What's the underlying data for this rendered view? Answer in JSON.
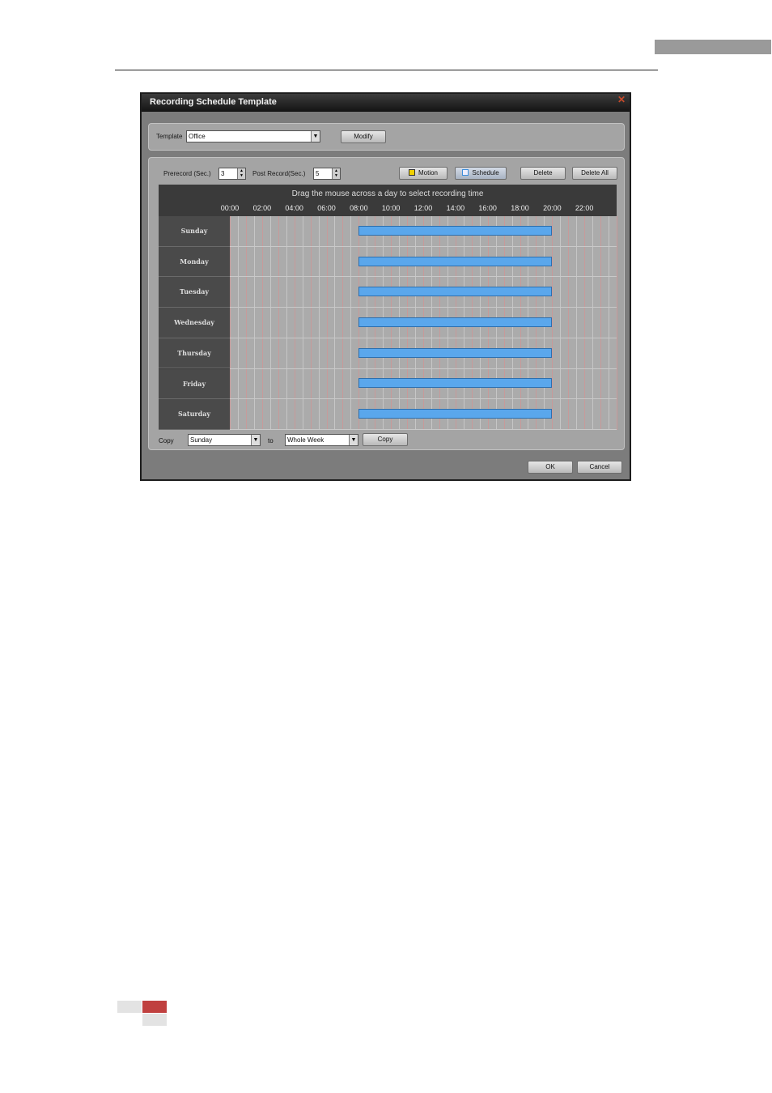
{
  "dialog": {
    "title": "Recording Schedule Template",
    "close_icon": "close-icon"
  },
  "template": {
    "label": "Template",
    "value": "Office",
    "modify_label": "Modify"
  },
  "record": {
    "prerecord_label": "Prerecord (Sec.)",
    "prerecord_value": "3",
    "postrecord_label": "Post Record(Sec.)",
    "postrecord_value": "5"
  },
  "types": {
    "motion_label": "Motion",
    "motion_color": "#f0d000",
    "schedule_label": "Schedule",
    "schedule_color": "#3c8edc",
    "delete_label": "Delete",
    "delete_all_label": "Delete All"
  },
  "schedule": {
    "hint": "Drag the mouse across a day to select recording time",
    "times": [
      "00:00",
      "02:00",
      "04:00",
      "06:00",
      "08:00",
      "10:00",
      "12:00",
      "14:00",
      "16:00",
      "18:00",
      "20:00",
      "22:00"
    ],
    "days": [
      {
        "name": "Sunday",
        "start": 8,
        "end": 20
      },
      {
        "name": "Monday",
        "start": 8,
        "end": 20
      },
      {
        "name": "Tuesday",
        "start": 8,
        "end": 20
      },
      {
        "name": "Wednesday",
        "start": 8,
        "end": 20
      },
      {
        "name": "Thursday",
        "start": 8,
        "end": 20
      },
      {
        "name": "Friday",
        "start": 8,
        "end": 20
      },
      {
        "name": "Saturday",
        "start": 8,
        "end": 20
      }
    ],
    "bar_color": "#5aa7ec",
    "grid_major_color": "#c79a9a",
    "grid_minor_color": "#c6c6c6",
    "cell_bg": "#ababab"
  },
  "copy": {
    "label": "Copy",
    "from_value": "Sunday",
    "to_label": "to",
    "to_value": "Whole Week",
    "button_label": "Copy"
  },
  "footer": {
    "ok_label": "OK",
    "cancel_label": "Cancel"
  }
}
